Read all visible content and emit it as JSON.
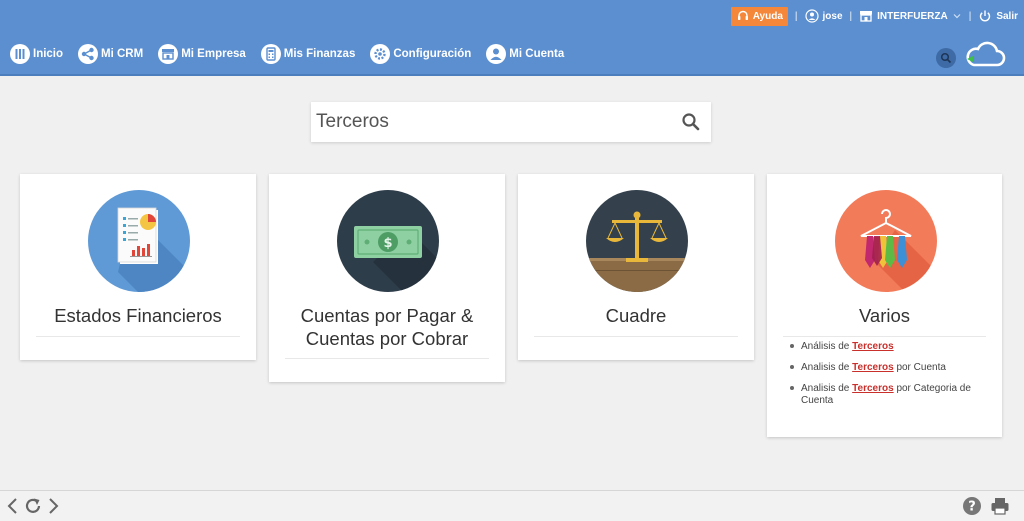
{
  "topbar": {
    "help_label": "Ayuda",
    "user_label": "jose",
    "company_label": "INTERFUERZA",
    "logout_label": "Salir",
    "separator": "|"
  },
  "nav": {
    "items": [
      {
        "label": "Inicio",
        "icon": "columns-icon"
      },
      {
        "label": "Mi CRM",
        "icon": "share-icon"
      },
      {
        "label": "Mi Empresa",
        "icon": "store-icon"
      },
      {
        "label": "Mis Finanzas",
        "icon": "calculator-icon"
      },
      {
        "label": "Configuración",
        "icon": "gear-icon"
      },
      {
        "label": "Mi Cuenta",
        "icon": "user-icon"
      }
    ]
  },
  "search": {
    "value": "Terceros"
  },
  "cards": [
    {
      "title": "Estados Financieros",
      "icon": "financial-report-icon"
    },
    {
      "title": "Cuentas por Pagar &",
      "title2": "Cuentas por Cobrar",
      "icon": "money-icon"
    },
    {
      "title": "Cuadre",
      "icon": "scale-icon"
    },
    {
      "title": "Varios",
      "icon": "ties-hanger-icon",
      "links": [
        {
          "prefix": "Análisis de",
          "highlight": "Terceros",
          "suffix": ""
        },
        {
          "prefix": "Analisis de",
          "highlight": "Terceros",
          "suffix": "por Cuenta"
        },
        {
          "prefix": "Analisis de",
          "highlight": "Terceros",
          "suffix": "por Categoria de Cuenta"
        }
      ]
    }
  ],
  "colors": {
    "header": "#5b8fd0",
    "help": "#f5873a",
    "highlight": "#c9302c"
  }
}
